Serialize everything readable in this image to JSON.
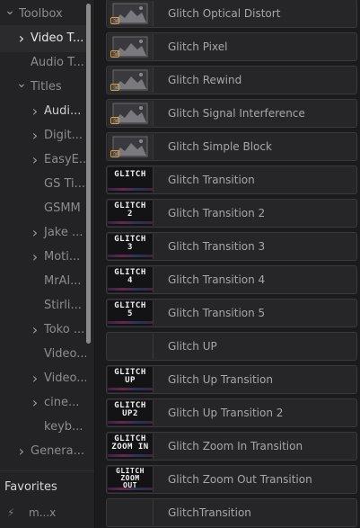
{
  "sidebar": {
    "tree": [
      {
        "label": "Toolbox",
        "chevron": "down",
        "indent": 0
      },
      {
        "label": "Video T...",
        "chevron": "right",
        "indent": 1,
        "selected": true
      },
      {
        "label": "Audio T...",
        "chevron": "",
        "indent": 1
      },
      {
        "label": "Titles",
        "chevron": "down",
        "indent": 1
      },
      {
        "label": "Audi...",
        "chevron": "right",
        "indent": 2,
        "bold": true
      },
      {
        "label": "Digit...",
        "chevron": "right",
        "indent": 2
      },
      {
        "label": "EasyE...",
        "chevron": "right",
        "indent": 2
      },
      {
        "label": "GS Ti...",
        "chevron": "",
        "indent": 2
      },
      {
        "label": "GSMM",
        "chevron": "",
        "indent": 2
      },
      {
        "label": "Jake ...",
        "chevron": "right",
        "indent": 2
      },
      {
        "label": "Moti...",
        "chevron": "right",
        "indent": 2
      },
      {
        "label": "MrAl...",
        "chevron": "",
        "indent": 2
      },
      {
        "label": "Stirli...",
        "chevron": "",
        "indent": 2
      },
      {
        "label": "Toko ...",
        "chevron": "right",
        "indent": 2
      },
      {
        "label": "Video...",
        "chevron": "",
        "indent": 2
      },
      {
        "label": "Video...",
        "chevron": "right",
        "indent": 2
      },
      {
        "label": "cine...",
        "chevron": "right",
        "indent": 2
      },
      {
        "label": "keyb...",
        "chevron": "",
        "indent": 2
      },
      {
        "label": "Genera...",
        "chevron": "right",
        "indent": 1
      }
    ],
    "favorites": {
      "title": "Favorites",
      "items": [
        {
          "icon": "bolt-icon",
          "label": "m...x"
        }
      ]
    }
  },
  "list": {
    "items": [
      {
        "label": "Glitch Optical Distort",
        "thumb": "landscape",
        "thumb_text": ""
      },
      {
        "label": "Glitch Pixel",
        "thumb": "landscape",
        "thumb_text": ""
      },
      {
        "label": "Glitch Rewind",
        "thumb": "landscape",
        "thumb_text": ""
      },
      {
        "label": "Glitch Signal Interference",
        "thumb": "landscape",
        "thumb_text": ""
      },
      {
        "label": "Glitch Simple Block",
        "thumb": "landscape",
        "thumb_text": ""
      },
      {
        "label": "Glitch Transition",
        "thumb": "text",
        "thumb_text": "GLITCH"
      },
      {
        "label": "Glitch Transition 2",
        "thumb": "text",
        "thumb_text": "GLITCH\n2"
      },
      {
        "label": "Glitch Transition 3",
        "thumb": "text",
        "thumb_text": "GLITCH\n3"
      },
      {
        "label": "Glitch Transition 4",
        "thumb": "text",
        "thumb_text": "GLITCH\n4"
      },
      {
        "label": "Glitch Transition 5",
        "thumb": "text",
        "thumb_text": "GLITCH\n5"
      },
      {
        "label": "Glitch UP",
        "thumb": "empty",
        "thumb_text": ""
      },
      {
        "label": "Glitch Up Transition",
        "thumb": "text",
        "thumb_text": "GLITCH\nUP"
      },
      {
        "label": "Glitch Up Transition 2",
        "thumb": "text",
        "thumb_text": "GLITCH\nUP2"
      },
      {
        "label": "Glitch Zoom In Transition",
        "thumb": "text",
        "thumb_text": "GLITCH\nZOOM IN"
      },
      {
        "label": "Glitch Zoom Out Transition",
        "thumb": "text",
        "thumb_text": "GLITCH\nZOOM\nOUT"
      },
      {
        "label": "GlitchTransition",
        "thumb": "empty",
        "thumb_text": ""
      }
    ]
  },
  "colors": {
    "accent_badge": "#e0a030",
    "selected_text": "#e6e6e6"
  }
}
